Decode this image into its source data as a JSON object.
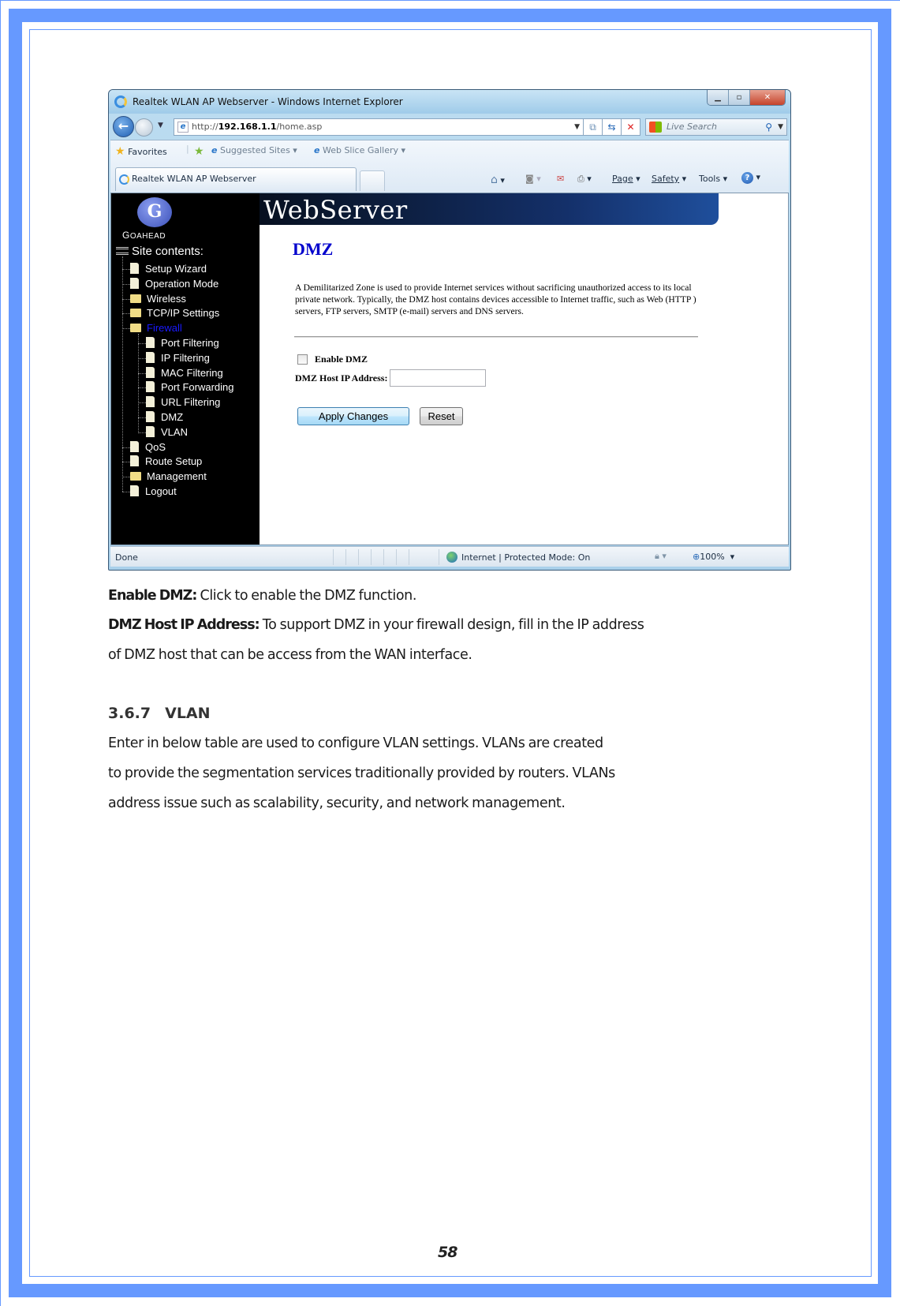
{
  "browser": {
    "window_title": "Realtek WLAN AP Webserver - Windows Internet Explorer",
    "url_prefix": "http://",
    "url_host": "192.168.1.1",
    "url_path": "/home.asp",
    "search_placeholder": "Live Search",
    "favorites_label": "Favorites",
    "suggested_sites_label": "Suggested Sites",
    "web_slice_label": "Web Slice Gallery",
    "tab_label": "Realtek WLAN AP Webserver",
    "commands": {
      "page": "Page",
      "safety": "Safety",
      "tools": "Tools"
    },
    "status": {
      "text": "Done",
      "zone": "Internet | Protected Mode: On",
      "zoom": "100%"
    }
  },
  "webapp": {
    "banner_title": "WebServer",
    "logo_text": "GoAhead",
    "site_contents_label": "Site contents:",
    "menu": [
      {
        "label": "Setup Wizard",
        "type": "page",
        "level": 1
      },
      {
        "label": "Operation Mode",
        "type": "page",
        "level": 1
      },
      {
        "label": "Wireless",
        "type": "folder",
        "level": 1
      },
      {
        "label": "TCP/IP Settings",
        "type": "folder",
        "level": 1
      },
      {
        "label": "Firewall",
        "type": "folder-open",
        "level": 1,
        "active": true
      },
      {
        "label": "Port Filtering",
        "type": "page",
        "level": 2
      },
      {
        "label": "IP Filtering",
        "type": "page",
        "level": 2
      },
      {
        "label": "MAC Filtering",
        "type": "page",
        "level": 2
      },
      {
        "label": "Port Forwarding",
        "type": "page",
        "level": 2
      },
      {
        "label": "URL Filtering",
        "type": "page",
        "level": 2
      },
      {
        "label": "DMZ",
        "type": "page",
        "level": 2
      },
      {
        "label": "VLAN",
        "type": "page",
        "level": 2
      },
      {
        "label": "QoS",
        "type": "page",
        "level": 1
      },
      {
        "label": "Route Setup",
        "type": "page",
        "level": 1
      },
      {
        "label": "Management",
        "type": "folder",
        "level": 1
      },
      {
        "label": "Logout",
        "type": "page",
        "level": 1
      }
    ],
    "dmz": {
      "title": "DMZ",
      "description": "A Demilitarized Zone is used to provide Internet services without sacrificing unauthorized access to its local private network. Typically, the DMZ host contains devices accessible to Internet traffic, such as Web (HTTP ) servers, FTP servers, SMTP (e-mail) servers and DNS servers.",
      "enable_label": "Enable DMZ",
      "enable_checked": false,
      "host_ip_label": "DMZ Host IP Address:",
      "host_ip_value": "",
      "apply_label": "Apply Changes",
      "reset_label": "Reset"
    }
  },
  "document": {
    "enable_dmz_term": "Enable DMZ:",
    "enable_dmz_desc": " Click to enable the DMZ function.",
    "host_ip_term": "DMZ Host IP Address:",
    "host_ip_desc_line1": " To support DMZ in your firewall design, fill in the IP address",
    "host_ip_desc_line2": "of DMZ host that can be access from the WAN interface.",
    "section_number": "3.6.7",
    "section_title": "VLAN",
    "vlan_para_line1": "Enter in below table are used to configure VLAN settings. VLANs are created",
    "vlan_para_line2": "to provide the segmentation services traditionally provided by routers. VLANs",
    "vlan_para_line3": "address issue such as scalability, security, and network management.",
    "page_number": "58"
  }
}
